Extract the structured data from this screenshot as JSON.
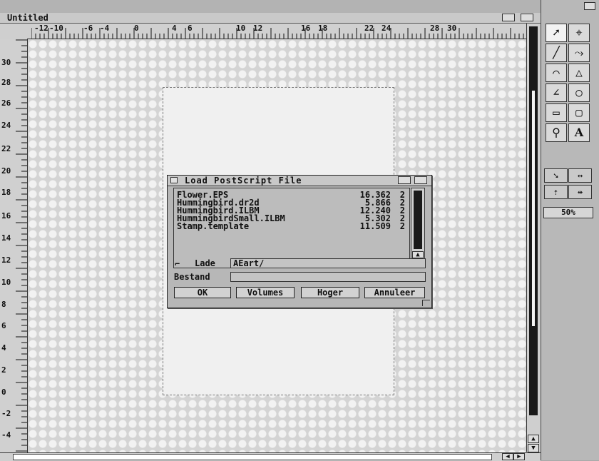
{
  "window": {
    "title": "Untitled"
  },
  "rulers": {
    "horizontal": [
      "-12",
      "-10",
      "-6",
      "-4",
      "0",
      "4",
      "6",
      "10",
      "12",
      "16",
      "18",
      "22",
      "24",
      "28",
      "30"
    ],
    "vertical": [
      "30",
      "28",
      "26",
      "24",
      "22",
      "20",
      "18",
      "16",
      "14",
      "12",
      "10",
      "8",
      "6",
      "4",
      "2",
      "0",
      "-2",
      "-4"
    ]
  },
  "dialog": {
    "title": "Load PostScript File",
    "files": [
      {
        "name": "Flower.EPS",
        "size": "16.362",
        "depth": "2"
      },
      {
        "name": "Hummingbird.dr2d",
        "size": "5.866",
        "depth": "2"
      },
      {
        "name": "Hummingbird.ILBM",
        "size": "12.240",
        "depth": "2"
      },
      {
        "name": "HummingbirdSmall.ILBM",
        "size": "5.302",
        "depth": "2"
      },
      {
        "name": "Stamp.template",
        "size": "11.509",
        "depth": "2"
      }
    ],
    "drawer_label": "Lade",
    "drawer_value": "AEart/",
    "file_label": "Bestand",
    "file_value": "",
    "buttons": {
      "ok": "OK",
      "volumes": "Volumes",
      "parent": "Hoger",
      "cancel": "Annuleer"
    }
  },
  "toolbox": {
    "zoom": "50%"
  }
}
